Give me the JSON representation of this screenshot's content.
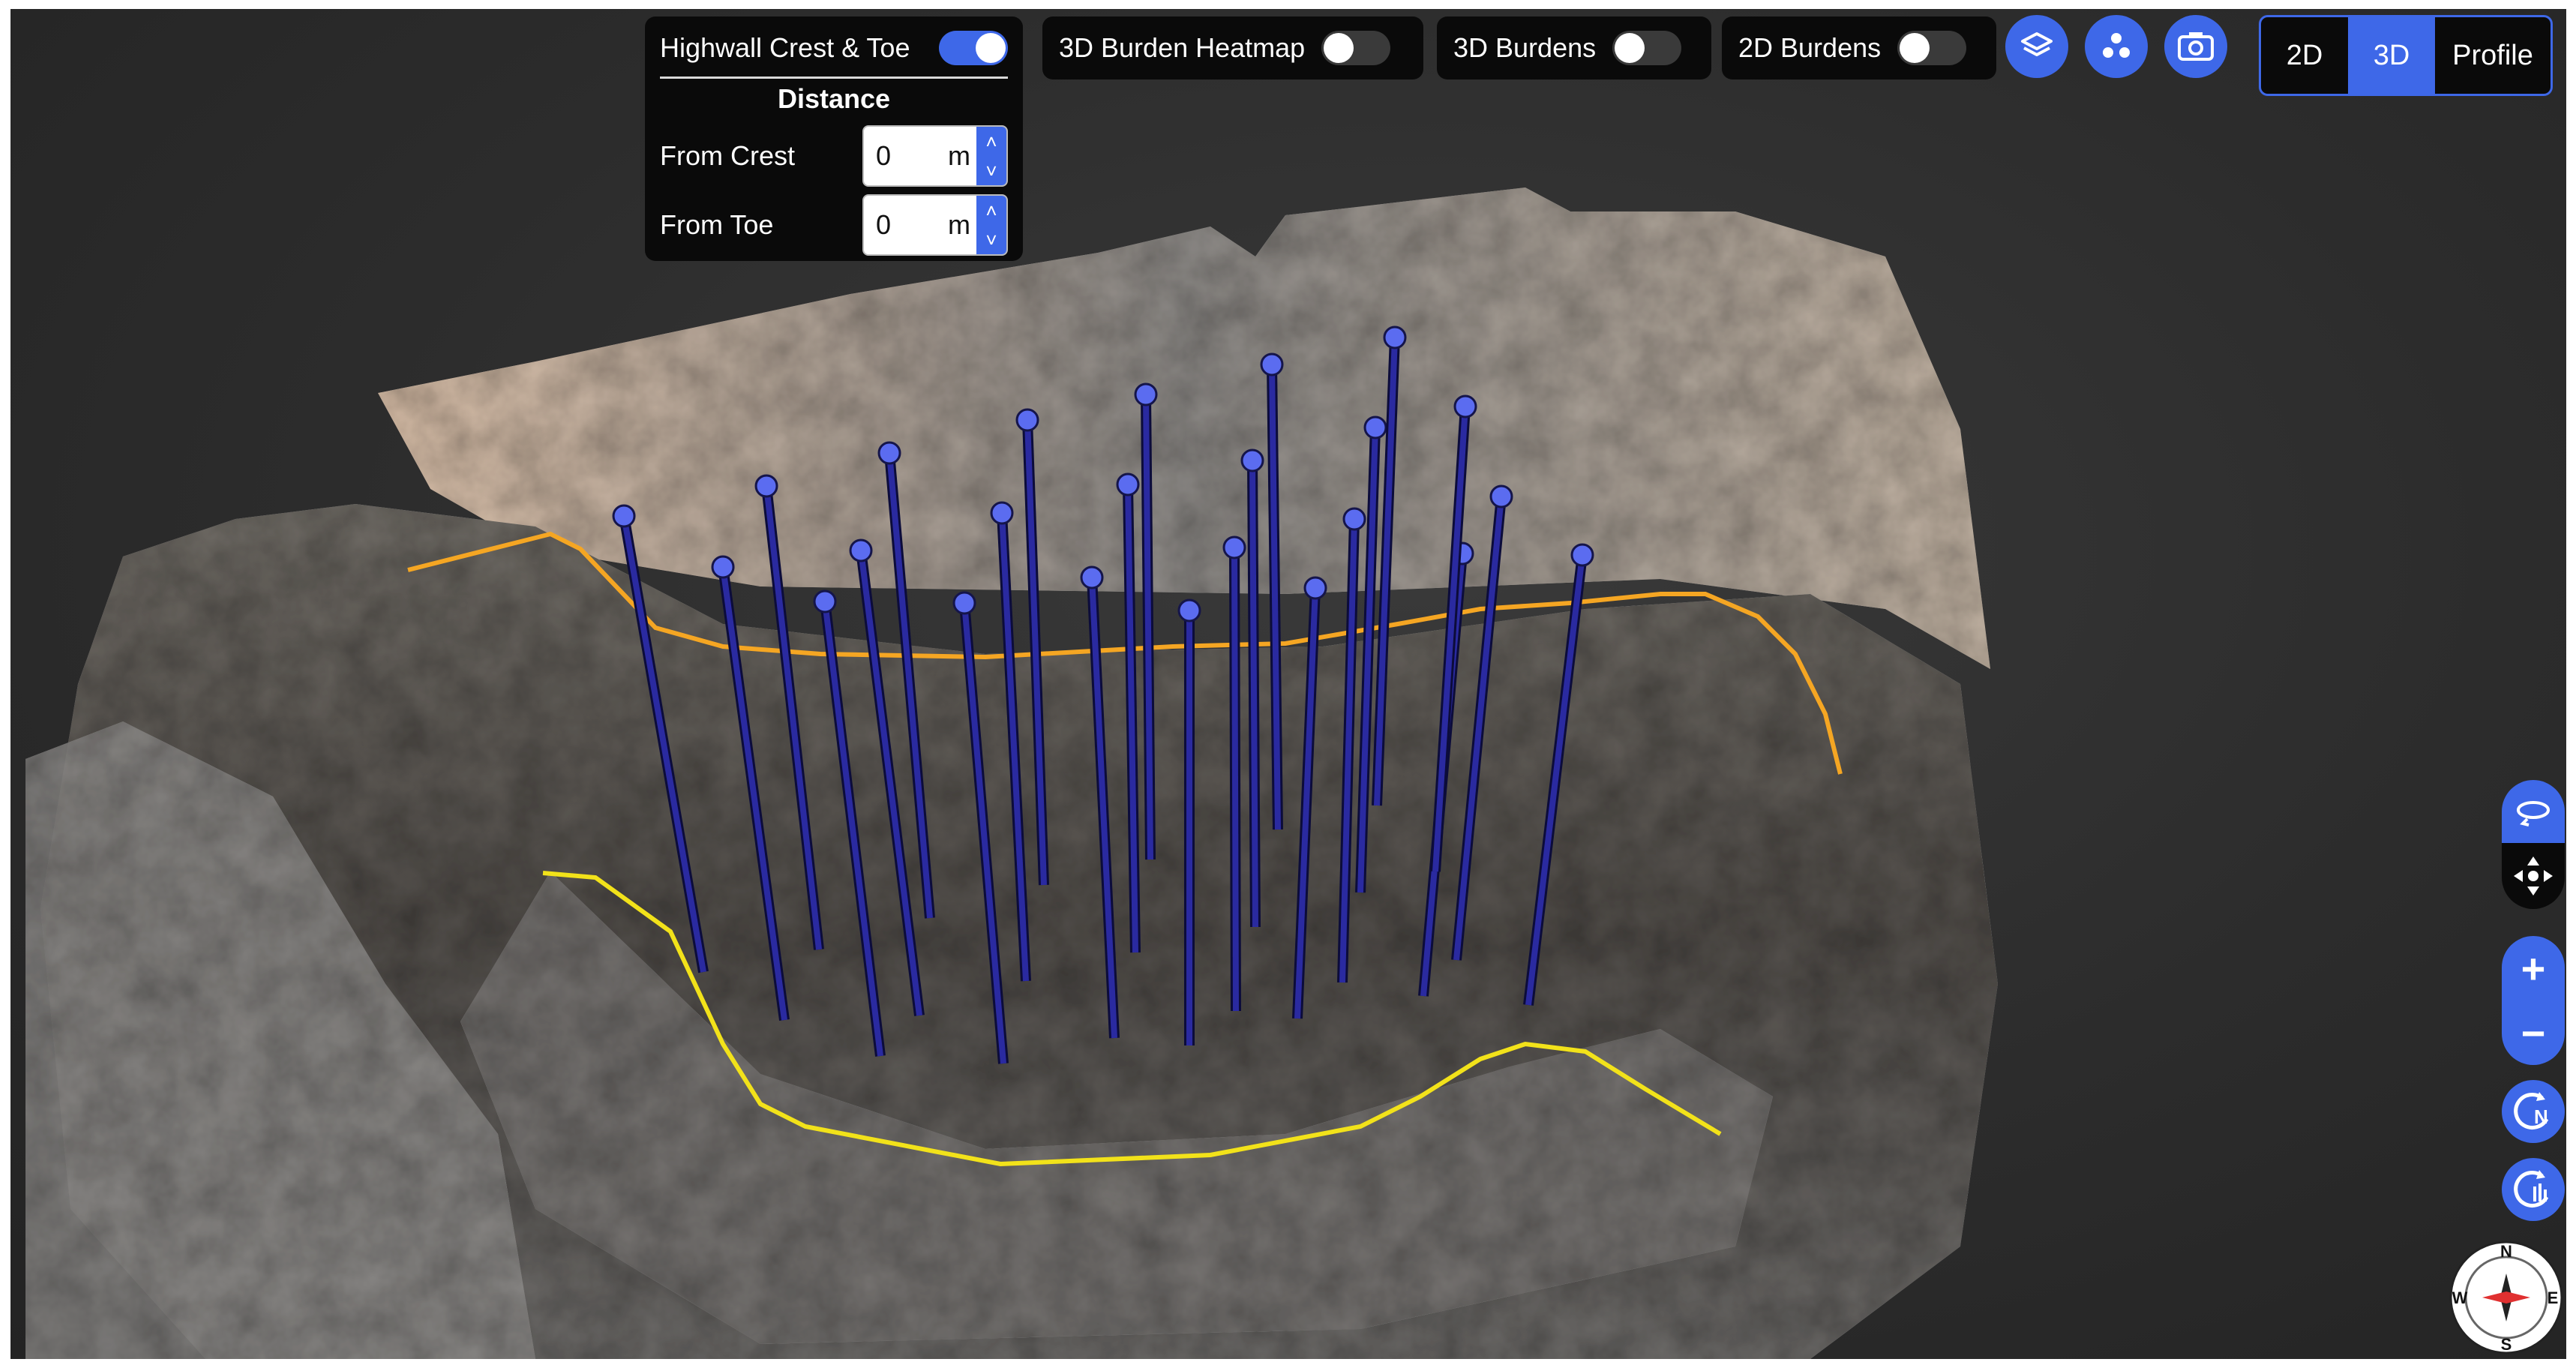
{
  "toolbar": {
    "highwall_label": "Highwall Crest & Toe",
    "highwall_on": true,
    "distance_title": "Distance",
    "from_crest_label": "From Crest",
    "from_crest_value": "0",
    "from_toe_label": "From Toe",
    "from_toe_value": "0",
    "unit": "m",
    "heatmap_label": "3D Burden Heatmap",
    "heatmap_on": false,
    "burdens3d_label": "3D Burdens",
    "burdens3d_on": false,
    "burdens2d_label": "2D Burdens",
    "burdens2d_on": false
  },
  "view_modes": [
    {
      "label": "2D",
      "active": false
    },
    {
      "label": "3D",
      "active": true
    },
    {
      "label": "Profile",
      "active": false
    }
  ],
  "icons": {
    "layers": "layers-icon",
    "points": "points-icon",
    "camera": "camera-icon",
    "orbit": "orbit-icon",
    "pan": "pan-icon",
    "zoom_in": "plus-icon",
    "zoom_out": "minus-icon",
    "reset_north": "reset-north-icon",
    "rotate": "rotate-icon"
  },
  "compass": {
    "n": "N",
    "s": "S",
    "e": "E",
    "w": "W"
  },
  "colors": {
    "accent": "#3e68e8",
    "crest_line": "#f5a623",
    "toe_line": "#f2e21a",
    "drill_hole": "#2a2aa0",
    "drill_head": "#5b6cf0"
  },
  "scene": {
    "drill_hole_count": 23,
    "crest_line_label": "highwall crest",
    "toe_line_label": "highwall toe"
  }
}
